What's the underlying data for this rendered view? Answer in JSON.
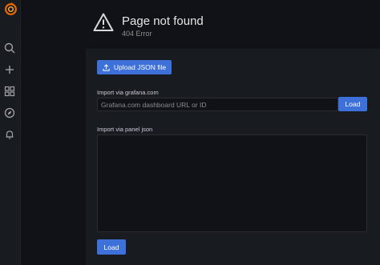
{
  "page": {
    "title": "Page not found",
    "subtitle": "404 Error",
    "icon": "warning-triangle-icon"
  },
  "sidebar": {
    "logo": "grafana-logo",
    "items": [
      {
        "icon": "search-icon"
      },
      {
        "icon": "plus-icon"
      },
      {
        "icon": "dashboards-icon"
      },
      {
        "icon": "compass-icon"
      },
      {
        "icon": "bell-icon"
      }
    ]
  },
  "import": {
    "upload_label": "Upload JSON file",
    "grafana_com_label": "Import via grafana.com",
    "grafana_com_placeholder": "Grafana.com dashboard URL or ID",
    "grafana_com_load_label": "Load",
    "panel_json_label": "Import via panel json",
    "panel_json_load_label": "Load"
  },
  "colors": {
    "background": "#111217",
    "panel": "#181b1f",
    "primary_button": "#3d71d9",
    "logo": "#f46800"
  }
}
